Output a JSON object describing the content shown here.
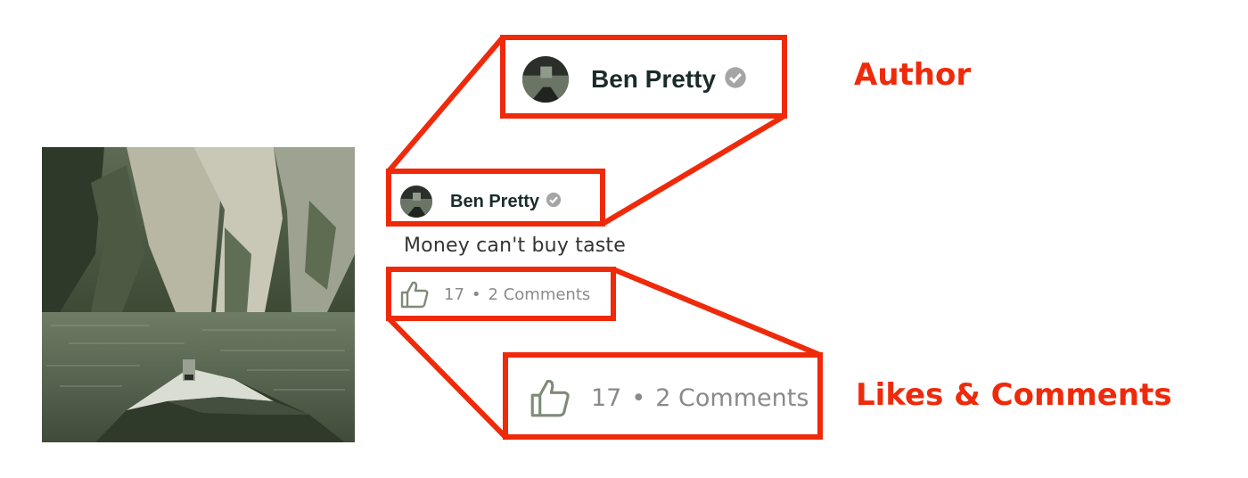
{
  "post": {
    "author_name": "Ben Pretty",
    "caption": "Money can't buy taste",
    "likes": "17",
    "separator": "•",
    "comments": "2 Comments"
  },
  "annotations": {
    "author_label": "Author",
    "likes_label": "Likes & Comments",
    "color": "#ef2a0b"
  },
  "icons": [
    "verified-badge-icon",
    "thumbs-up-icon"
  ]
}
